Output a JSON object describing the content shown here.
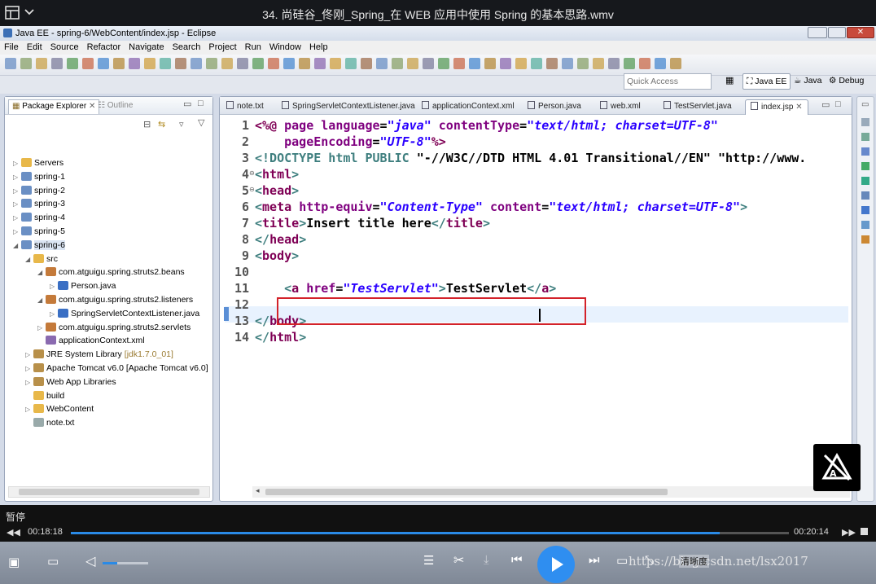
{
  "video": {
    "title": "34. 尚硅谷_佟刚_Spring_在 WEB 应用中使用 Spring 的基本思路.wmv",
    "status": "暂停",
    "elapsed": "00:18:18",
    "duration": "00:20:14",
    "progress": 0.904,
    "watermark": "https://blog.csdn.net/lsx2017",
    "clear_label": "清晰度"
  },
  "window": {
    "title": "Java EE - spring-6/WebContent/index.jsp - Eclipse"
  },
  "menu": [
    "File",
    "Edit",
    "Source",
    "Refactor",
    "Navigate",
    "Search",
    "Project",
    "Run",
    "Window",
    "Help"
  ],
  "quick_access": "Quick Access",
  "perspectives": [
    "Java EE",
    "Java",
    "Debug"
  ],
  "explorer": {
    "tab_active": "Package Explorer",
    "tab_other": "Outline",
    "tree": [
      {
        "label": "Servers",
        "indent": 0,
        "arrow": "▷",
        "icon": "folder-icon"
      },
      {
        "label": "spring-1",
        "indent": 0,
        "arrow": "▷",
        "icon": "project-icon"
      },
      {
        "label": "spring-2",
        "indent": 0,
        "arrow": "▷",
        "icon": "project-icon"
      },
      {
        "label": "spring-3",
        "indent": 0,
        "arrow": "▷",
        "icon": "project-icon"
      },
      {
        "label": "spring-4",
        "indent": 0,
        "arrow": "▷",
        "icon": "project-icon"
      },
      {
        "label": "spring-5",
        "indent": 0,
        "arrow": "▷",
        "icon": "project-icon"
      },
      {
        "label": "spring-6",
        "indent": 0,
        "arrow": "◢",
        "icon": "project-icon"
      },
      {
        "label": "src",
        "indent": 1,
        "arrow": "◢",
        "icon": "src-folder-icon"
      },
      {
        "label": "com.atguigu.spring.struts2.beans",
        "indent": 2,
        "arrow": "◢",
        "icon": "package-icon"
      },
      {
        "label": "Person.java",
        "indent": 3,
        "arrow": "▷",
        "icon": "java-file-icon"
      },
      {
        "label": "com.atguigu.spring.struts2.listeners",
        "indent": 2,
        "arrow": "◢",
        "icon": "package-icon"
      },
      {
        "label": "SpringServletContextListener.java",
        "indent": 3,
        "arrow": "▷",
        "icon": "java-file-icon"
      },
      {
        "label": "com.atguigu.spring.struts2.servlets",
        "indent": 2,
        "arrow": "▷",
        "icon": "package-icon"
      },
      {
        "label": "applicationContext.xml",
        "indent": 2,
        "arrow": "",
        "icon": "xml-file-icon"
      },
      {
        "label": "JRE System Library",
        "suffix": "[jdk1.7.0_01]",
        "indent": 1,
        "arrow": "▷",
        "icon": "library-icon"
      },
      {
        "label": "Apache Tomcat v6.0 [Apache Tomcat v6.0]",
        "indent": 1,
        "arrow": "▷",
        "icon": "library-icon"
      },
      {
        "label": "Web App Libraries",
        "indent": 1,
        "arrow": "▷",
        "icon": "library-icon"
      },
      {
        "label": "build",
        "indent": 1,
        "arrow": "",
        "icon": "folder-icon"
      },
      {
        "label": "WebContent",
        "indent": 1,
        "arrow": "▷",
        "icon": "folder-icon"
      },
      {
        "label": "note.txt",
        "indent": 1,
        "arrow": "",
        "icon": "text-file-icon"
      }
    ]
  },
  "editor": {
    "tabs": [
      "note.txt",
      "SpringServletContextListener.java",
      "applicationContext.xml",
      "Person.java",
      "web.xml",
      "TestServlet.java",
      "index.jsp"
    ],
    "active_tab": "index.jsp",
    "line_numbers": [
      "1",
      "2",
      "3",
      "4",
      "5",
      "6",
      "7",
      "8",
      "9",
      "10",
      "11",
      "12",
      "13",
      "14"
    ],
    "lines": [
      [
        [
          "kw",
          "<%@ "
        ],
        [
          "at",
          "page "
        ],
        [
          "at",
          "language"
        ],
        [
          "tx",
          "="
        ],
        [
          "str",
          "\"java\""
        ],
        [
          "tx",
          " "
        ],
        [
          "at",
          "contentType"
        ],
        [
          "tx",
          "="
        ],
        [
          "str",
          "\"text/html; charset=UTF-8\""
        ]
      ],
      [
        [
          "tx",
          "    "
        ],
        [
          "at",
          "pageEncoding"
        ],
        [
          "tx",
          "="
        ],
        [
          "str",
          "\"UTF-8\""
        ],
        [
          "kw",
          "%>"
        ]
      ],
      [
        [
          "tg",
          "<!DOCTYPE html PUBLIC "
        ],
        [
          "tx",
          "\"-//W3C//DTD HTML 4.01 Transitional//EN\" \"http://www."
        ]
      ],
      [
        [
          "tg",
          "<"
        ],
        [
          "kw",
          "html"
        ],
        [
          "tg",
          ">"
        ]
      ],
      [
        [
          "tg",
          "<"
        ],
        [
          "kw",
          "head"
        ],
        [
          "tg",
          ">"
        ]
      ],
      [
        [
          "tg",
          "<"
        ],
        [
          "kw",
          "meta "
        ],
        [
          "at",
          "http-equiv"
        ],
        [
          "tx",
          "="
        ],
        [
          "str",
          "\"Content-Type\""
        ],
        [
          "tx",
          " "
        ],
        [
          "at",
          "content"
        ],
        [
          "tx",
          "="
        ],
        [
          "str",
          "\"text/html; charset=UTF-8\""
        ],
        [
          "tg",
          ">"
        ]
      ],
      [
        [
          "tg",
          "<"
        ],
        [
          "kw",
          "title"
        ],
        [
          "tg",
          ">"
        ],
        [
          "tx",
          "Insert title here"
        ],
        [
          "tg",
          "</"
        ],
        [
          "kw",
          "title"
        ],
        [
          "tg",
          ">"
        ]
      ],
      [
        [
          "tg",
          "</"
        ],
        [
          "kw",
          "head"
        ],
        [
          "tg",
          ">"
        ]
      ],
      [
        [
          "tg",
          "<"
        ],
        [
          "kw",
          "body"
        ],
        [
          "tg",
          ">"
        ]
      ],
      [
        [
          "tx",
          ""
        ]
      ],
      [
        [
          "tx",
          "    "
        ],
        [
          "tg",
          "<"
        ],
        [
          "kw",
          "a "
        ],
        [
          "at",
          "href"
        ],
        [
          "tx",
          "="
        ],
        [
          "str",
          "\"TestServlet\""
        ],
        [
          "tg",
          ">"
        ],
        [
          "tx",
          "TestServlet"
        ],
        [
          "tg",
          "</"
        ],
        [
          "kw",
          "a"
        ],
        [
          "tg",
          ">"
        ]
      ],
      [
        [
          "tx",
          ""
        ]
      ],
      [
        [
          "tg",
          "</"
        ],
        [
          "kw",
          "body"
        ],
        [
          "tg",
          ">"
        ]
      ],
      [
        [
          "tg",
          "</"
        ],
        [
          "kw",
          "html"
        ],
        [
          "tg",
          ">"
        ]
      ]
    ]
  }
}
